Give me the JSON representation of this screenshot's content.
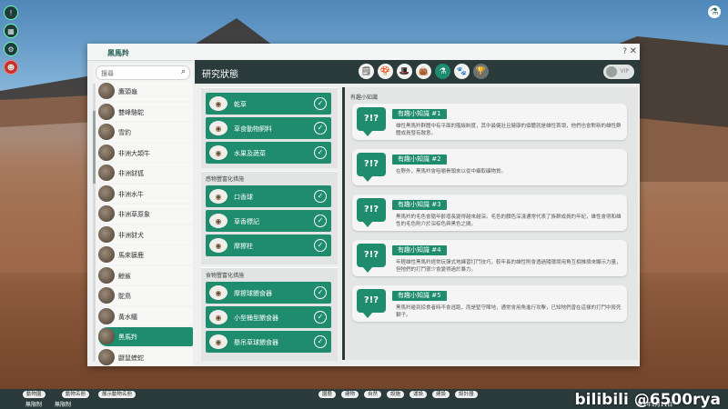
{
  "window": {
    "title": "黑馬羚",
    "help": "?",
    "close": "✕"
  },
  "search": {
    "placeholder": "搜尋"
  },
  "animals": [
    {
      "label": "鷹頭龜"
    },
    {
      "label": "雙峰駱駝"
    },
    {
      "label": "雪豹"
    },
    {
      "label": "非洲大頡牛"
    },
    {
      "label": "非洲豺狐"
    },
    {
      "label": "非洲水牛"
    },
    {
      "label": "非洲草原象"
    },
    {
      "label": "非洲豺犬"
    },
    {
      "label": "馬來貘鹿"
    },
    {
      "label": "鯨鯊"
    },
    {
      "label": "鴕鳥"
    },
    {
      "label": "黃水鱷"
    },
    {
      "label": "黑馬羚",
      "selected": true
    },
    {
      "label": "鼴鼠蝰蛇"
    }
  ],
  "header": {
    "title": "研究狀態",
    "vip_label": "VIP"
  },
  "tabs": [
    {
      "icon": "food-icon",
      "glyph": "🗒"
    },
    {
      "icon": "mushroom-icon",
      "glyph": "🍄"
    },
    {
      "icon": "hat-icon",
      "glyph": "🎩"
    },
    {
      "icon": "bag-icon",
      "glyph": "👜"
    },
    {
      "icon": "flask-icon",
      "glyph": "⚗",
      "selected": true
    },
    {
      "icon": "paw-icon",
      "glyph": "🐾"
    },
    {
      "icon": "trophy-icon",
      "glyph": "🏆",
      "disabled": true
    }
  ],
  "food": {
    "items": [
      {
        "label": "乾草"
      },
      {
        "label": "草食動物飼料"
      },
      {
        "label": "水果及蔬菜"
      }
    ]
  },
  "enrichment_sense": {
    "title": "感物豐富化措施",
    "items": [
      {
        "label": "口香球"
      },
      {
        "label": "草香標記"
      },
      {
        "label": "摩擦柱"
      }
    ]
  },
  "enrichment_food": {
    "title": "食物豐富化措施",
    "items": [
      {
        "label": "摩擦球餵食器"
      },
      {
        "label": "小型桶型餵食器"
      },
      {
        "label": "懸吊草球餵食器"
      }
    ]
  },
  "trivia": {
    "title": "有趣小知識",
    "facts": [
      {
        "title": "有趣小知識 #1",
        "text": "雄性黑馬羚群體中有平面的階級制度，其中最健壯且健康的個體就是雄性首領，他們也會對新的雄性群體成員發有敵意。"
      },
      {
        "title": "有趣小知識 #2",
        "text": "在野外，黑馬羚會咀嚼骨頭來以從中攝取礦物質。"
      },
      {
        "title": "有趣小知識 #3",
        "text": "黑馬羚的毛色會隨年齡增長變得越來越深。毛色的顏色深淺通常代表了族群成員的年紀，雄性會得和雄性的毛色則介於深棕色與黑色之間。"
      },
      {
        "title": "有趣小知識 #4",
        "text": "年輕雄性黑馬羚經常玩彈式地練習打鬥技巧，較年長的雄性則會透過隨環境用角互相推擠來顯示力量，但牠們的打鬥很少會變得過於暴力。"
      },
      {
        "title": "有趣小知識 #5",
        "text": "黑馬羚碰到掠食者時不會逃跑，而是堅守陣地，通常會用角進行攻擊，已知牠們曾在這樣的打鬥中殺死獅子。"
      }
    ]
  },
  "bottom": {
    "buttons": [
      "動物園",
      "動物名冊",
      "展示動物名冊"
    ],
    "left_status": [
      "無限制",
      "無限制"
    ],
    "tools": [
      "園藝",
      "建物",
      "自然",
      "設施",
      "運設",
      "建設",
      "設計器"
    ],
    "date": "第1年1月11日",
    "watermark": "bilibili @6500rya"
  },
  "colors": {
    "accent": "#1e8c6d",
    "dark": "#2b3b3b"
  }
}
